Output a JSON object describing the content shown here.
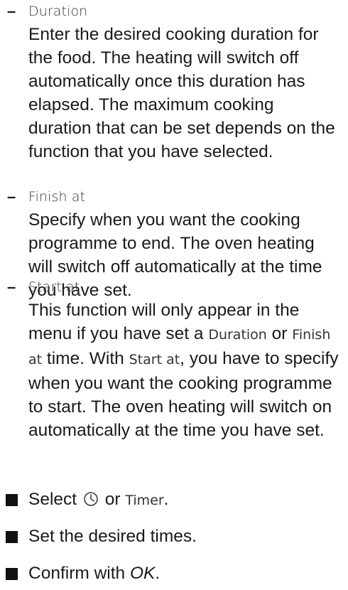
{
  "options": [
    {
      "term": "Duration",
      "description": "Enter the desired cooking duration for the food. The heating will switch off automatically once this duration has elapsed. The maximum cooking duration that can be set depends on the function that you have selected."
    },
    {
      "term": "Finish at",
      "description": "Specify when you want the cooking programme to end. The oven heating will switch off automatically at the time you have set."
    },
    {
      "term": "Start at",
      "desc_part1": "This function will only appear in the menu if you have set a",
      "desc_term1": "Duration",
      "desc_part2": "or",
      "desc_term2": "Finish at",
      "desc_part3": "time. With",
      "desc_term3": "Start at",
      "desc_part4": ", you have to specify when you want the cooking programme to start. The oven heating will switch on automatically at the time you have set."
    }
  ],
  "steps": [
    {
      "prefix": "Select",
      "icon": "clock-icon",
      "middle": "or",
      "term": "Timer",
      "suffix": "."
    },
    {
      "text": "Set the desired times."
    },
    {
      "prefix": "Confirm with",
      "emphasis": "OK",
      "suffix": "."
    }
  ]
}
